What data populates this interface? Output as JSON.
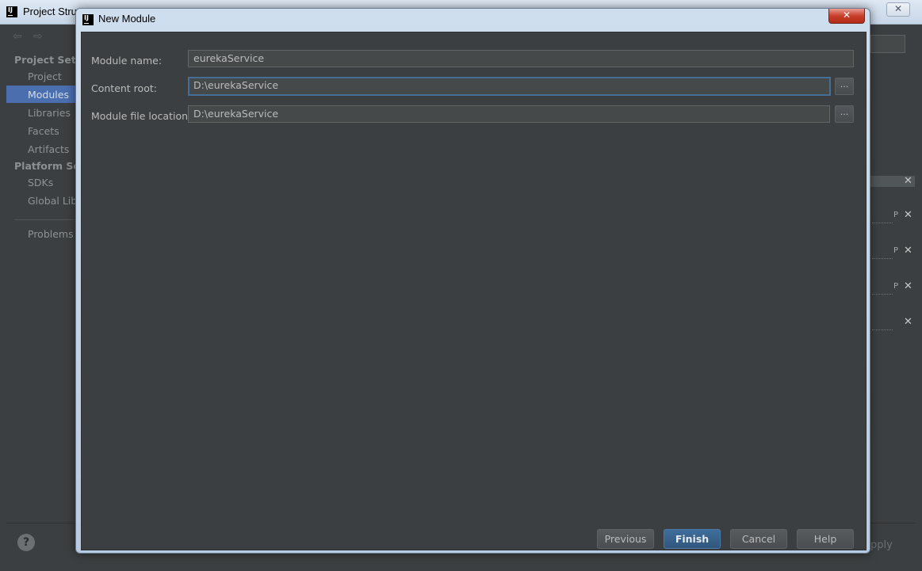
{
  "background_window": {
    "title": "Project Stru",
    "close_glyph": "✕",
    "nav_back_glyph": "⇦",
    "nav_forward_glyph": "⇨",
    "project_settings_heading": "Project Setti",
    "items_project": [
      "Project",
      "Modules",
      "Libraries",
      "Facets",
      "Artifacts"
    ],
    "platform_settings_heading": "Platform Set",
    "items_platform": [
      "SDKs",
      "Global Lib"
    ],
    "problems": "Problems",
    "help_glyph": "?",
    "apply_label": "pply",
    "remove_glyph": "✕",
    "path_glyph": "P"
  },
  "dialog": {
    "title": "New Module",
    "close_glyph": "✕",
    "fields": {
      "module_name": {
        "label": "Module name:",
        "value": "eurekaService"
      },
      "content_root": {
        "label": "Content root:",
        "value": "D:\\eurekaService"
      },
      "module_file_location": {
        "label": "Module file location:",
        "value": "D:\\eurekaService"
      }
    },
    "browse_label": "...",
    "buttons": {
      "previous": "Previous",
      "finish": "Finish",
      "cancel": "Cancel",
      "help": "Help"
    }
  },
  "colors": {
    "accent_selection": "#4b6eaf",
    "panel_background": "#3c3f41",
    "focus_border": "#466d94"
  }
}
